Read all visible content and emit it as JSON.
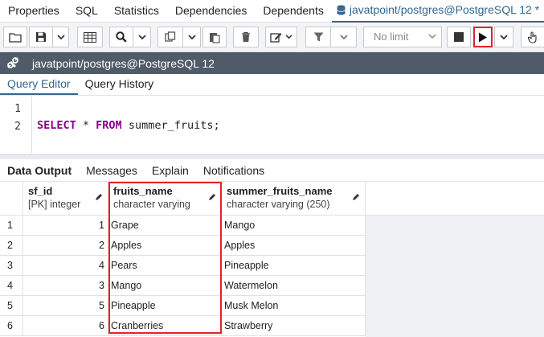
{
  "top_tabs": {
    "items": [
      "Properties",
      "SQL",
      "Statistics",
      "Dependencies",
      "Dependents"
    ],
    "active": "javatpoint/postgres@PostgreSQL 12 *"
  },
  "toolbar": {
    "limit_value": "No limit"
  },
  "connection": {
    "label": "javatpoint/postgres@PostgreSQL 12"
  },
  "editor_tabs": [
    "Query Editor",
    "Query History"
  ],
  "editor": {
    "line_numbers": [
      "1",
      "2"
    ],
    "code_line": {
      "kw1": "SELECT",
      "star": " * ",
      "kw2": "FROM",
      "rest": " summer_fruits;"
    }
  },
  "output_tabs": [
    "Data Output",
    "Messages",
    "Explain",
    "Notifications"
  ],
  "grid": {
    "columns": [
      {
        "name": "sf_id",
        "type": "[PK] integer"
      },
      {
        "name": "fruits_name",
        "type": "character varying"
      },
      {
        "name": "summer_fruits_name",
        "type": "character varying (250)"
      }
    ],
    "rows": [
      {
        "n": "1",
        "sf_id": "1",
        "fruits_name": "Grape",
        "summer_fruits_name": "Mango"
      },
      {
        "n": "2",
        "sf_id": "2",
        "fruits_name": "Apples",
        "summer_fruits_name": "Apples"
      },
      {
        "n": "3",
        "sf_id": "4",
        "fruits_name": "Pears",
        "summer_fruits_name": "Pineapple"
      },
      {
        "n": "4",
        "sf_id": "3",
        "fruits_name": "Mango",
        "summer_fruits_name": "Watermelon"
      },
      {
        "n": "5",
        "sf_id": "5",
        "fruits_name": "Pineapple",
        "summer_fruits_name": "Musk Melon"
      },
      {
        "n": "6",
        "sf_id": "6",
        "fruits_name": "Cranberries",
        "summer_fruits_name": "Strawberry"
      }
    ]
  },
  "colors": {
    "accent": "#326690",
    "highlight": "#e0242a",
    "connbar": "#4f5b68"
  }
}
